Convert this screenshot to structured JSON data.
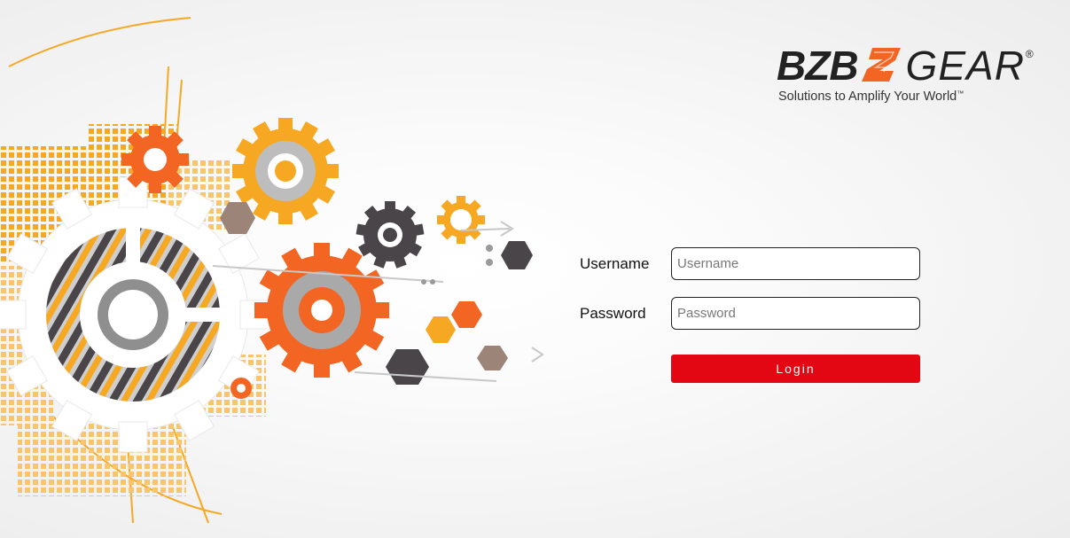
{
  "brand": {
    "name_part1": "BZB",
    "name_part2": "GEAR",
    "registered_mark": "®",
    "tagline": "Solutions to Amplify Your World",
    "tagline_tm": "™",
    "accent_color": "#f26522"
  },
  "login_form": {
    "username_label": "Username",
    "username_placeholder": "Username",
    "username_value": "",
    "password_label": "Password",
    "password_placeholder": "Password",
    "password_value": "",
    "login_label": "Login",
    "button_color": "#e30613"
  },
  "icons": {
    "hero": "gears-illustration",
    "logo_mark": "bzb-2-logo-mark"
  }
}
